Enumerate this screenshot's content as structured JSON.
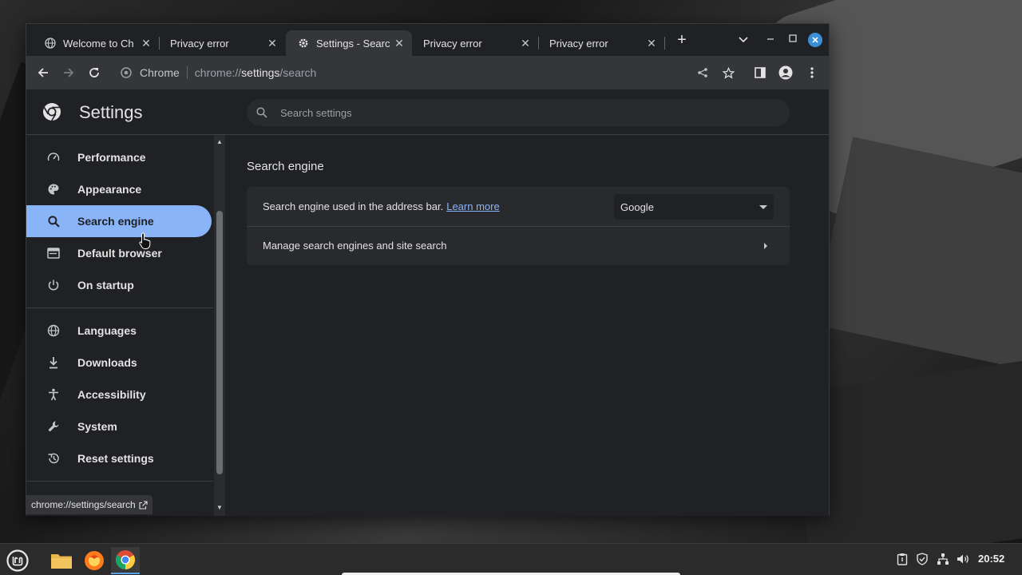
{
  "tabs": [
    {
      "label": "Welcome to Ch",
      "icon": "globe-icon",
      "close": "✕"
    },
    {
      "label": "Privacy error",
      "icon": "",
      "close": "✕"
    },
    {
      "label": "Settings - Searc",
      "icon": "gear-icon",
      "close": "✕",
      "active": true
    },
    {
      "label": "Privacy error",
      "icon": "",
      "close": "✕"
    },
    {
      "label": "Privacy error",
      "icon": "",
      "close": "✕"
    }
  ],
  "new_tab": "+",
  "omnibox": {
    "chip": "Chrome",
    "url_prefix": "chrome://",
    "url_host": "settings",
    "url_path": "/search"
  },
  "settings": {
    "title": "Settings",
    "search_placeholder": "Search settings"
  },
  "sidebar": {
    "items": [
      {
        "label": "Performance",
        "icon": "speedometer-icon"
      },
      {
        "label": "Appearance",
        "icon": "palette-icon"
      },
      {
        "label": "Search engine",
        "icon": "search-icon",
        "selected": true
      },
      {
        "label": "Default browser",
        "icon": "browser-icon"
      },
      {
        "label": "On startup",
        "icon": "power-icon"
      },
      {
        "label": "Languages",
        "icon": "globe-icon"
      },
      {
        "label": "Downloads",
        "icon": "download-icon"
      },
      {
        "label": "Accessibility",
        "icon": "accessibility-icon"
      },
      {
        "label": "System",
        "icon": "wrench-icon"
      },
      {
        "label": "Reset settings",
        "icon": "reset-icon"
      }
    ]
  },
  "status_bubble": "chrome://settings/search",
  "content": {
    "section_title": "Search engine",
    "row1_text": "Search engine used in the address bar.",
    "row1_link": "Learn more",
    "select_value": "Google",
    "row2_text": "Manage search engines and site search"
  },
  "taskbar": {
    "clock": "20:52"
  },
  "colors": {
    "accent": "#8ab4f8",
    "page_bg": "#202124",
    "card_bg": "#292a2d",
    "toolbar_bg": "#35363a"
  }
}
